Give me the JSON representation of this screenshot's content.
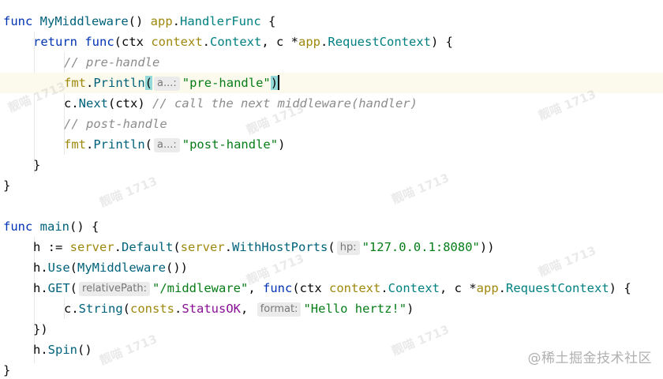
{
  "code": {
    "l1": {
      "kw_func": "func",
      "name": "MyMiddleware",
      "sig": "() ",
      "pkg": "app",
      "dot": ".",
      "type": "HandlerFunc",
      "tail": " {"
    },
    "l2": {
      "kw_return": "return",
      "kw_func": "func",
      "open": "(ctx ",
      "pkg1": "context",
      "type1": "Context",
      "mid": ", c *",
      "pkg2": "app",
      "type2": "RequestContext",
      "tail": ") {"
    },
    "l3": {
      "comment": "// pre-handle"
    },
    "l4": {
      "pkg": "fmt",
      "fn": "Println",
      "hint": "a...:",
      "str": "\"pre-handle\"",
      "close": ")"
    },
    "l5": {
      "obj": "c.",
      "fn": "Next",
      "args": "(ctx) ",
      "comment": "// call the next middleware(handler)"
    },
    "l6": {
      "comment": "// post-handle"
    },
    "l7": {
      "pkg": "fmt",
      "fn": "Println",
      "hint": "a...:",
      "str": "\"post-handle\"",
      "close": ")"
    },
    "l8": {
      "text": "}"
    },
    "l9": {
      "text": "}"
    },
    "l11": {
      "kw_func": "func",
      "name": "main",
      "tail": "() {"
    },
    "l12": {
      "lhs": "h := ",
      "pkg": "server",
      "fn": "Default",
      "open": "(",
      "pkg2": "server",
      "fn2": "WithHostPorts",
      "hint": "hp:",
      "str": "\"127.0.0.1:8080\"",
      "close": "))"
    },
    "l13": {
      "obj": "h.",
      "fn": "Use",
      "open": "(",
      "fn2": "MyMiddleware",
      "close": "())"
    },
    "l14": {
      "obj": "h.",
      "fn": "GET",
      "hint": "relativePath:",
      "str": "\"/middleware\"",
      "mid": ", ",
      "kw_func": "func",
      "args": "(ctx ",
      "pkg1": "context",
      "type1": "Context",
      "mid2": ", c *",
      "pkg2": "app",
      "type2": "RequestContext",
      "tail": ") {"
    },
    "l15": {
      "obj": "c.",
      "fn": "String",
      "open": "(",
      "pkg": "consts",
      "const": "StatusOK",
      "mid": ", ",
      "hint": "format:",
      "str": "\"Hello hertz!\"",
      "close": ")"
    },
    "l16": {
      "text": "})"
    },
    "l17": {
      "obj": "h.",
      "fn": "Spin",
      "tail": "()"
    },
    "l18": {
      "text": "}"
    }
  },
  "watermarks": {
    "text": "靓喵 1713",
    "footer": "@稀土掘金技术社区"
  },
  "colors": {
    "keyword": "#0033b3",
    "function": "#00627a",
    "package": "#871094",
    "string": "#067d17",
    "comment": "#8c8c8c",
    "current_line": "#fcfaed",
    "brace_highlight": "#93d9d9"
  }
}
